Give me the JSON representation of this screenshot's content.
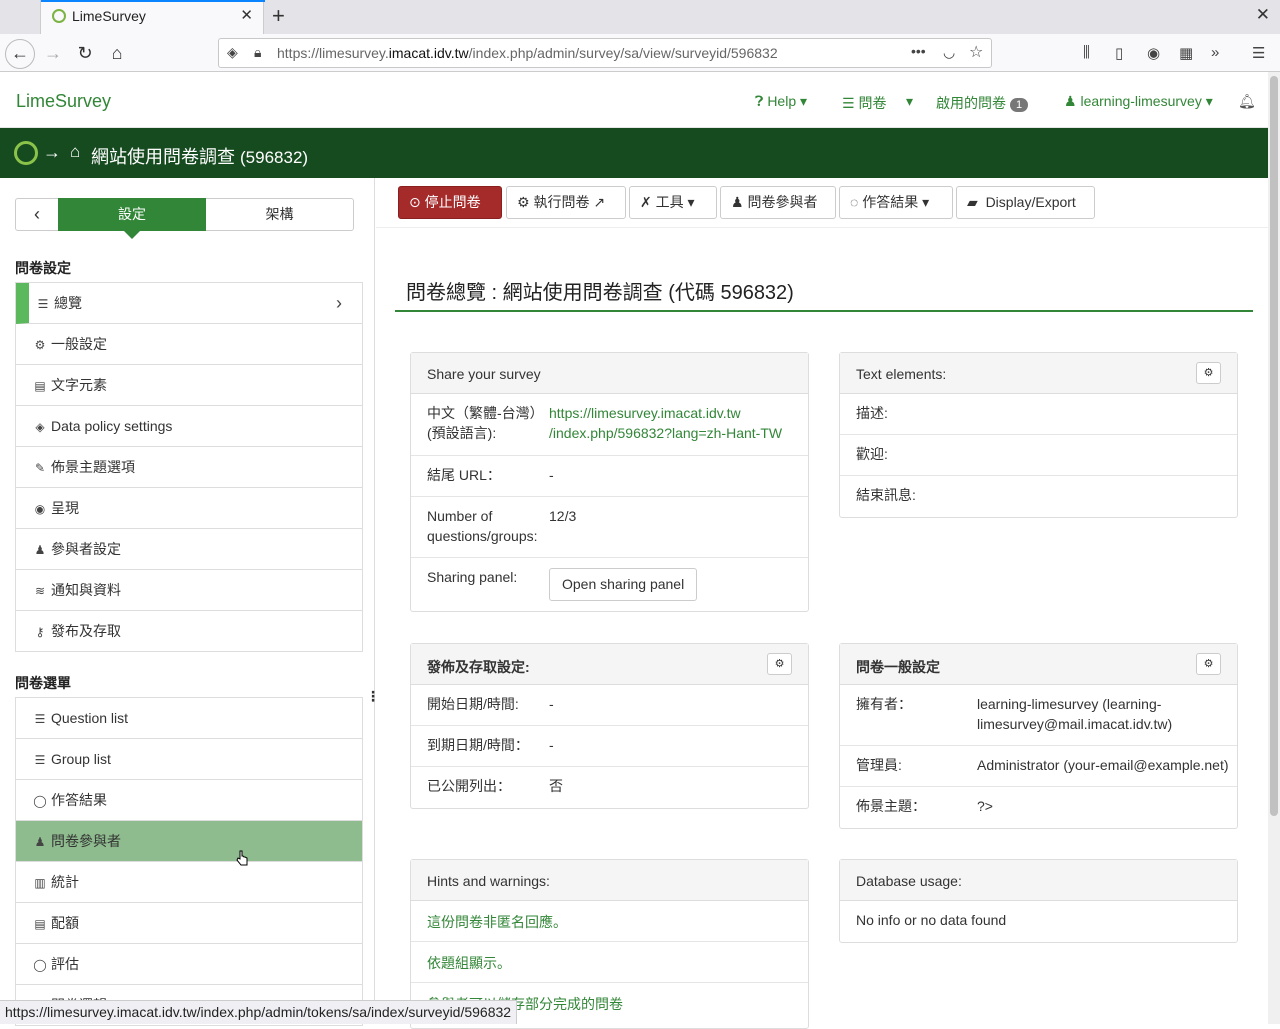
{
  "browser": {
    "tab_title": "LimeSurvey",
    "new_tab": "+",
    "close": "✕",
    "url_prefix": "https://limesurvey.",
    "url_domain": "imacat.idv.tw",
    "url_path": "/index.php/admin/survey/sa/view/surveyid/596832",
    "status_url": "https://limesurvey.imacat.idv.tw/index.php/admin/tokens/sa/index/surveyid/596832"
  },
  "header": {
    "brand": "LimeSurvey",
    "help": "Help",
    "surveys": "問卷",
    "active_surveys": "啟用的問卷",
    "active_count": "1",
    "user": "learning-limesurvey"
  },
  "survey_bar": {
    "title": "網站使用問卷調查",
    "id": "(596832)"
  },
  "sidebar": {
    "tab_settings": "設定",
    "tab_structure": "架構",
    "section_settings": "問卷設定",
    "settings_items": [
      {
        "label": "總覽",
        "icon": "☰"
      },
      {
        "label": "一般設定",
        "icon": "⚙"
      },
      {
        "label": "文字元素",
        "icon": "▤"
      },
      {
        "label": "Data policy settings",
        "icon": "◈"
      },
      {
        "label": "佈景主題選項",
        "icon": "✎"
      },
      {
        "label": "呈現",
        "icon": "◉"
      },
      {
        "label": "參與者設定",
        "icon": "♟"
      },
      {
        "label": "通知與資料",
        "icon": "≋"
      },
      {
        "label": "發布及存取",
        "icon": "⚷"
      }
    ],
    "section_menu": "問卷選單",
    "menu_items": [
      {
        "label": "Question list",
        "icon": "☰"
      },
      {
        "label": "Group list",
        "icon": "☰"
      },
      {
        "label": "作答結果",
        "icon": "◯"
      },
      {
        "label": "問卷參與者",
        "icon": "♟"
      },
      {
        "label": "統計",
        "icon": "▥"
      },
      {
        "label": "配額",
        "icon": "▤"
      },
      {
        "label": "評估",
        "icon": "◯"
      },
      {
        "label": "問卷邏輯",
        "icon": "☰"
      }
    ]
  },
  "toolbar": {
    "stop": "停止問卷",
    "execute": "執行問卷",
    "tools": "工具",
    "participants": "問卷參與者",
    "responses": "作答結果",
    "display_export": "Display/Export"
  },
  "page": {
    "heading_label": "問卷總覽",
    "heading_title": "網站使用問卷調查 (代碼 596832)"
  },
  "share_panel": {
    "title": "Share your survey",
    "lang_label": "中文（繁體-台灣）(預設語言):",
    "link_line1": "https://limesurvey.imacat.idv.tw",
    "link_line2": "/index.php/596832?lang=zh-Hant-TW",
    "end_url_label": "結尾 URL：",
    "end_url_value": "-",
    "count_label": "Number of questions/groups:",
    "count_value": "12/3",
    "sharing_label": "Sharing panel:",
    "sharing_button": "Open sharing panel"
  },
  "text_panel": {
    "title": "Text elements:",
    "description": "描述:",
    "welcome": "歡迎:",
    "end_message": "結束訊息:"
  },
  "publish_panel": {
    "title": "發佈及存取設定:",
    "start_label": "開始日期/時間:",
    "start_value": "-",
    "expiry_label": "到期日期/時間：",
    "expiry_value": "-",
    "public_label": "已公開列出：",
    "public_value": "否"
  },
  "general_panel": {
    "title": "問卷一般設定",
    "owner_label": "擁有者：",
    "owner_value": "learning-limesurvey (learning-limesurvey@mail.imacat.idv.tw)",
    "admin_label": "管理員:",
    "admin_value": "Administrator (your-email@example.net)",
    "theme_label": "佈景主題：",
    "theme_value": "?>"
  },
  "hints_panel": {
    "title": "Hints and warnings:",
    "hints": [
      "這份問卷非匿名回應。",
      "依題組顯示。",
      "參與者可以儲存部分完成的問卷"
    ]
  },
  "db_panel": {
    "title": "Database usage:",
    "message": "No info or no data found"
  }
}
